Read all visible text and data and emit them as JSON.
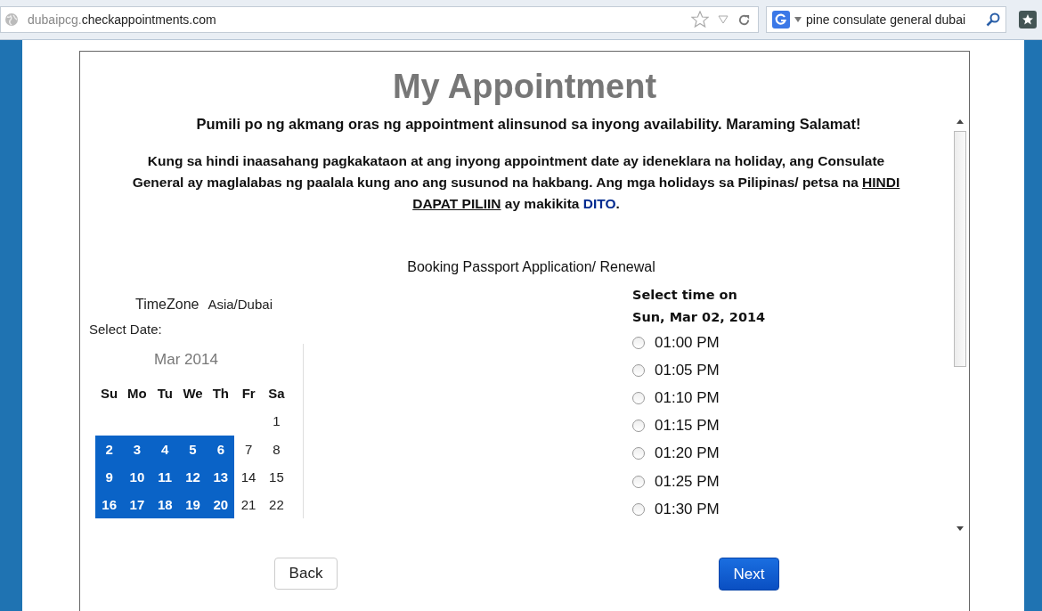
{
  "browser": {
    "url_prefix": "dubaipcg.",
    "url_domain": "checkappointments.com",
    "search_value": "pine consulate general dubai"
  },
  "page": {
    "title": "My Appointment",
    "subtitle": "Pumili po ng akmang oras ng appointment alinsunod sa inyong availability. Maraming Salamat!",
    "notice": [
      {
        "kind": "plain",
        "text": "Kung sa hindi inaasahang pagkakataon at ang inyong appointment date ay ideneklara na holiday, ang Consulate General ay maglalabas ng paalala kung ano ang susunod na hakbang. Ang mga holidays sa Pilipinas/ petsa na "
      },
      {
        "kind": "underline",
        "text": "HINDI DAPAT PILIIN"
      },
      {
        "kind": "plain",
        "text": " ay makikita "
      },
      {
        "kind": "link",
        "text": "DITO"
      },
      {
        "kind": "plain",
        "text": "."
      }
    ],
    "booking_type": "Booking Passport Application/ Renewal",
    "timezone_label": "TimeZone",
    "timezone_value": "Asia/Dubai",
    "select_date_label": "Select Date:",
    "calendar": {
      "month": "Mar 2014",
      "weekdays": [
        "Su",
        "Mo",
        "Tu",
        "We",
        "Th",
        "Fr",
        "Sa"
      ],
      "weeks": [
        [
          {
            "day": "1",
            "available": false
          }
        ],
        [
          {
            "day": "2",
            "available": true
          },
          {
            "day": "3",
            "available": true
          },
          {
            "day": "4",
            "available": true
          },
          {
            "day": "5",
            "available": true
          },
          {
            "day": "6",
            "available": true
          },
          {
            "day": "7",
            "available": false
          },
          {
            "day": "8",
            "available": false
          }
        ],
        [
          {
            "day": "9",
            "available": true
          },
          {
            "day": "10",
            "available": true
          },
          {
            "day": "11",
            "available": true
          },
          {
            "day": "12",
            "available": true
          },
          {
            "day": "13",
            "available": true
          },
          {
            "day": "14",
            "available": false
          },
          {
            "day": "15",
            "available": false
          }
        ],
        [
          {
            "day": "16",
            "available": true
          },
          {
            "day": "17",
            "available": true
          },
          {
            "day": "18",
            "available": true
          },
          {
            "day": "19",
            "available": true
          },
          {
            "day": "20",
            "available": true
          },
          {
            "day": "21",
            "available": false
          },
          {
            "day": "22",
            "available": false
          }
        ]
      ]
    },
    "time_heading": "Select time on",
    "time_date": "Sun, Mar 02, 2014",
    "times": [
      {
        "label": "01:00 PM",
        "selected": false
      },
      {
        "label": "01:05 PM",
        "selected": false
      },
      {
        "label": "01:10 PM",
        "selected": false
      },
      {
        "label": "01:15 PM",
        "selected": false
      },
      {
        "label": "01:20 PM",
        "selected": false
      },
      {
        "label": "01:25 PM",
        "selected": false
      },
      {
        "label": "01:30 PM",
        "selected": false
      }
    ],
    "buttons": {
      "back": "Back",
      "next": "Next"
    }
  }
}
